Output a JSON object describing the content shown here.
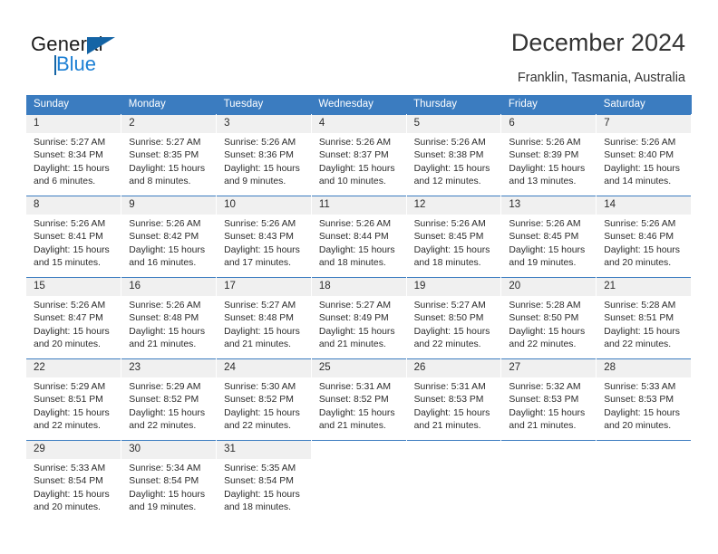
{
  "brand": {
    "name_part1": "General",
    "name_part2": "Blue",
    "triangle_color": "#1464a5",
    "blue_color": "#1b7fd4"
  },
  "header": {
    "title": "December 2024",
    "subtitle": "Franklin, Tasmania, Australia",
    "header_bg": "#3b7cc0",
    "daynum_bg": "#f0f0f0"
  },
  "weekdays": [
    "Sunday",
    "Monday",
    "Tuesday",
    "Wednesday",
    "Thursday",
    "Friday",
    "Saturday"
  ],
  "labels": {
    "sunrise_prefix": "Sunrise:",
    "sunset_prefix": "Sunset:",
    "daylight_prefix": "Daylight:"
  },
  "weeks": [
    [
      {
        "day": "1",
        "sunrise": "Sunrise: 5:27 AM",
        "sunset": "Sunset: 8:34 PM",
        "daylight_line1": "Daylight: 15 hours",
        "daylight_line2": "and 6 minutes."
      },
      {
        "day": "2",
        "sunrise": "Sunrise: 5:27 AM",
        "sunset": "Sunset: 8:35 PM",
        "daylight_line1": "Daylight: 15 hours",
        "daylight_line2": "and 8 minutes."
      },
      {
        "day": "3",
        "sunrise": "Sunrise: 5:26 AM",
        "sunset": "Sunset: 8:36 PM",
        "daylight_line1": "Daylight: 15 hours",
        "daylight_line2": "and 9 minutes."
      },
      {
        "day": "4",
        "sunrise": "Sunrise: 5:26 AM",
        "sunset": "Sunset: 8:37 PM",
        "daylight_line1": "Daylight: 15 hours",
        "daylight_line2": "and 10 minutes."
      },
      {
        "day": "5",
        "sunrise": "Sunrise: 5:26 AM",
        "sunset": "Sunset: 8:38 PM",
        "daylight_line1": "Daylight: 15 hours",
        "daylight_line2": "and 12 minutes."
      },
      {
        "day": "6",
        "sunrise": "Sunrise: 5:26 AM",
        "sunset": "Sunset: 8:39 PM",
        "daylight_line1": "Daylight: 15 hours",
        "daylight_line2": "and 13 minutes."
      },
      {
        "day": "7",
        "sunrise": "Sunrise: 5:26 AM",
        "sunset": "Sunset: 8:40 PM",
        "daylight_line1": "Daylight: 15 hours",
        "daylight_line2": "and 14 minutes."
      }
    ],
    [
      {
        "day": "8",
        "sunrise": "Sunrise: 5:26 AM",
        "sunset": "Sunset: 8:41 PM",
        "daylight_line1": "Daylight: 15 hours",
        "daylight_line2": "and 15 minutes."
      },
      {
        "day": "9",
        "sunrise": "Sunrise: 5:26 AM",
        "sunset": "Sunset: 8:42 PM",
        "daylight_line1": "Daylight: 15 hours",
        "daylight_line2": "and 16 minutes."
      },
      {
        "day": "10",
        "sunrise": "Sunrise: 5:26 AM",
        "sunset": "Sunset: 8:43 PM",
        "daylight_line1": "Daylight: 15 hours",
        "daylight_line2": "and 17 minutes."
      },
      {
        "day": "11",
        "sunrise": "Sunrise: 5:26 AM",
        "sunset": "Sunset: 8:44 PM",
        "daylight_line1": "Daylight: 15 hours",
        "daylight_line2": "and 18 minutes."
      },
      {
        "day": "12",
        "sunrise": "Sunrise: 5:26 AM",
        "sunset": "Sunset: 8:45 PM",
        "daylight_line1": "Daylight: 15 hours",
        "daylight_line2": "and 18 minutes."
      },
      {
        "day": "13",
        "sunrise": "Sunrise: 5:26 AM",
        "sunset": "Sunset: 8:45 PM",
        "daylight_line1": "Daylight: 15 hours",
        "daylight_line2": "and 19 minutes."
      },
      {
        "day": "14",
        "sunrise": "Sunrise: 5:26 AM",
        "sunset": "Sunset: 8:46 PM",
        "daylight_line1": "Daylight: 15 hours",
        "daylight_line2": "and 20 minutes."
      }
    ],
    [
      {
        "day": "15",
        "sunrise": "Sunrise: 5:26 AM",
        "sunset": "Sunset: 8:47 PM",
        "daylight_line1": "Daylight: 15 hours",
        "daylight_line2": "and 20 minutes."
      },
      {
        "day": "16",
        "sunrise": "Sunrise: 5:26 AM",
        "sunset": "Sunset: 8:48 PM",
        "daylight_line1": "Daylight: 15 hours",
        "daylight_line2": "and 21 minutes."
      },
      {
        "day": "17",
        "sunrise": "Sunrise: 5:27 AM",
        "sunset": "Sunset: 8:48 PM",
        "daylight_line1": "Daylight: 15 hours",
        "daylight_line2": "and 21 minutes."
      },
      {
        "day": "18",
        "sunrise": "Sunrise: 5:27 AM",
        "sunset": "Sunset: 8:49 PM",
        "daylight_line1": "Daylight: 15 hours",
        "daylight_line2": "and 21 minutes."
      },
      {
        "day": "19",
        "sunrise": "Sunrise: 5:27 AM",
        "sunset": "Sunset: 8:50 PM",
        "daylight_line1": "Daylight: 15 hours",
        "daylight_line2": "and 22 minutes."
      },
      {
        "day": "20",
        "sunrise": "Sunrise: 5:28 AM",
        "sunset": "Sunset: 8:50 PM",
        "daylight_line1": "Daylight: 15 hours",
        "daylight_line2": "and 22 minutes."
      },
      {
        "day": "21",
        "sunrise": "Sunrise: 5:28 AM",
        "sunset": "Sunset: 8:51 PM",
        "daylight_line1": "Daylight: 15 hours",
        "daylight_line2": "and 22 minutes."
      }
    ],
    [
      {
        "day": "22",
        "sunrise": "Sunrise: 5:29 AM",
        "sunset": "Sunset: 8:51 PM",
        "daylight_line1": "Daylight: 15 hours",
        "daylight_line2": "and 22 minutes."
      },
      {
        "day": "23",
        "sunrise": "Sunrise: 5:29 AM",
        "sunset": "Sunset: 8:52 PM",
        "daylight_line1": "Daylight: 15 hours",
        "daylight_line2": "and 22 minutes."
      },
      {
        "day": "24",
        "sunrise": "Sunrise: 5:30 AM",
        "sunset": "Sunset: 8:52 PM",
        "daylight_line1": "Daylight: 15 hours",
        "daylight_line2": "and 22 minutes."
      },
      {
        "day": "25",
        "sunrise": "Sunrise: 5:31 AM",
        "sunset": "Sunset: 8:52 PM",
        "daylight_line1": "Daylight: 15 hours",
        "daylight_line2": "and 21 minutes."
      },
      {
        "day": "26",
        "sunrise": "Sunrise: 5:31 AM",
        "sunset": "Sunset: 8:53 PM",
        "daylight_line1": "Daylight: 15 hours",
        "daylight_line2": "and 21 minutes."
      },
      {
        "day": "27",
        "sunrise": "Sunrise: 5:32 AM",
        "sunset": "Sunset: 8:53 PM",
        "daylight_line1": "Daylight: 15 hours",
        "daylight_line2": "and 21 minutes."
      },
      {
        "day": "28",
        "sunrise": "Sunrise: 5:33 AM",
        "sunset": "Sunset: 8:53 PM",
        "daylight_line1": "Daylight: 15 hours",
        "daylight_line2": "and 20 minutes."
      }
    ],
    [
      {
        "day": "29",
        "sunrise": "Sunrise: 5:33 AM",
        "sunset": "Sunset: 8:54 PM",
        "daylight_line1": "Daylight: 15 hours",
        "daylight_line2": "and 20 minutes."
      },
      {
        "day": "30",
        "sunrise": "Sunrise: 5:34 AM",
        "sunset": "Sunset: 8:54 PM",
        "daylight_line1": "Daylight: 15 hours",
        "daylight_line2": "and 19 minutes."
      },
      {
        "day": "31",
        "sunrise": "Sunrise: 5:35 AM",
        "sunset": "Sunset: 8:54 PM",
        "daylight_line1": "Daylight: 15 hours",
        "daylight_line2": "and 18 minutes."
      },
      {
        "day": "",
        "sunrise": "",
        "sunset": "",
        "daylight_line1": "",
        "daylight_line2": ""
      },
      {
        "day": "",
        "sunrise": "",
        "sunset": "",
        "daylight_line1": "",
        "daylight_line2": ""
      },
      {
        "day": "",
        "sunrise": "",
        "sunset": "",
        "daylight_line1": "",
        "daylight_line2": ""
      },
      {
        "day": "",
        "sunrise": "",
        "sunset": "",
        "daylight_line1": "",
        "daylight_line2": ""
      }
    ]
  ]
}
